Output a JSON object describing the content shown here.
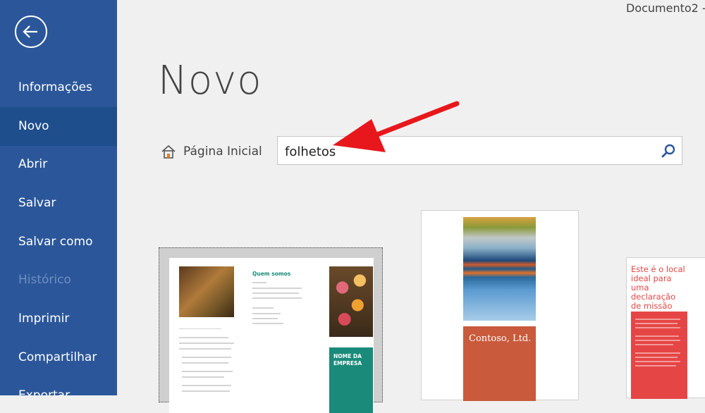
{
  "app": {
    "document_title": "Documento2  -"
  },
  "sidebar": {
    "items": [
      {
        "label": "Informações"
      },
      {
        "label": "Novo"
      },
      {
        "label": "Abrir"
      },
      {
        "label": "Salvar"
      },
      {
        "label": "Salvar como"
      },
      {
        "label": "Histórico"
      },
      {
        "label": "Imprimir"
      },
      {
        "label": "Compartilhar"
      },
      {
        "label": "Exportar"
      }
    ]
  },
  "main": {
    "title": "Novo",
    "home_label": "Página Inicial",
    "search_value": "folhetos"
  },
  "templates": {
    "t1": {
      "heading": "Quem somos",
      "company_name": "NOME DA EMPRESA"
    },
    "t2": {
      "company": "Contoso, Ltd."
    },
    "t3": {
      "heading": "Este é o local ideal para uma declaração de missão"
    }
  },
  "colors": {
    "sidebar": "#2b579a",
    "sidebar_active": "#1e4e8c",
    "arrow": "#e8171c",
    "teal": "#1a8a7a",
    "contoso": "#c95a3c",
    "mission": "#e64545"
  }
}
